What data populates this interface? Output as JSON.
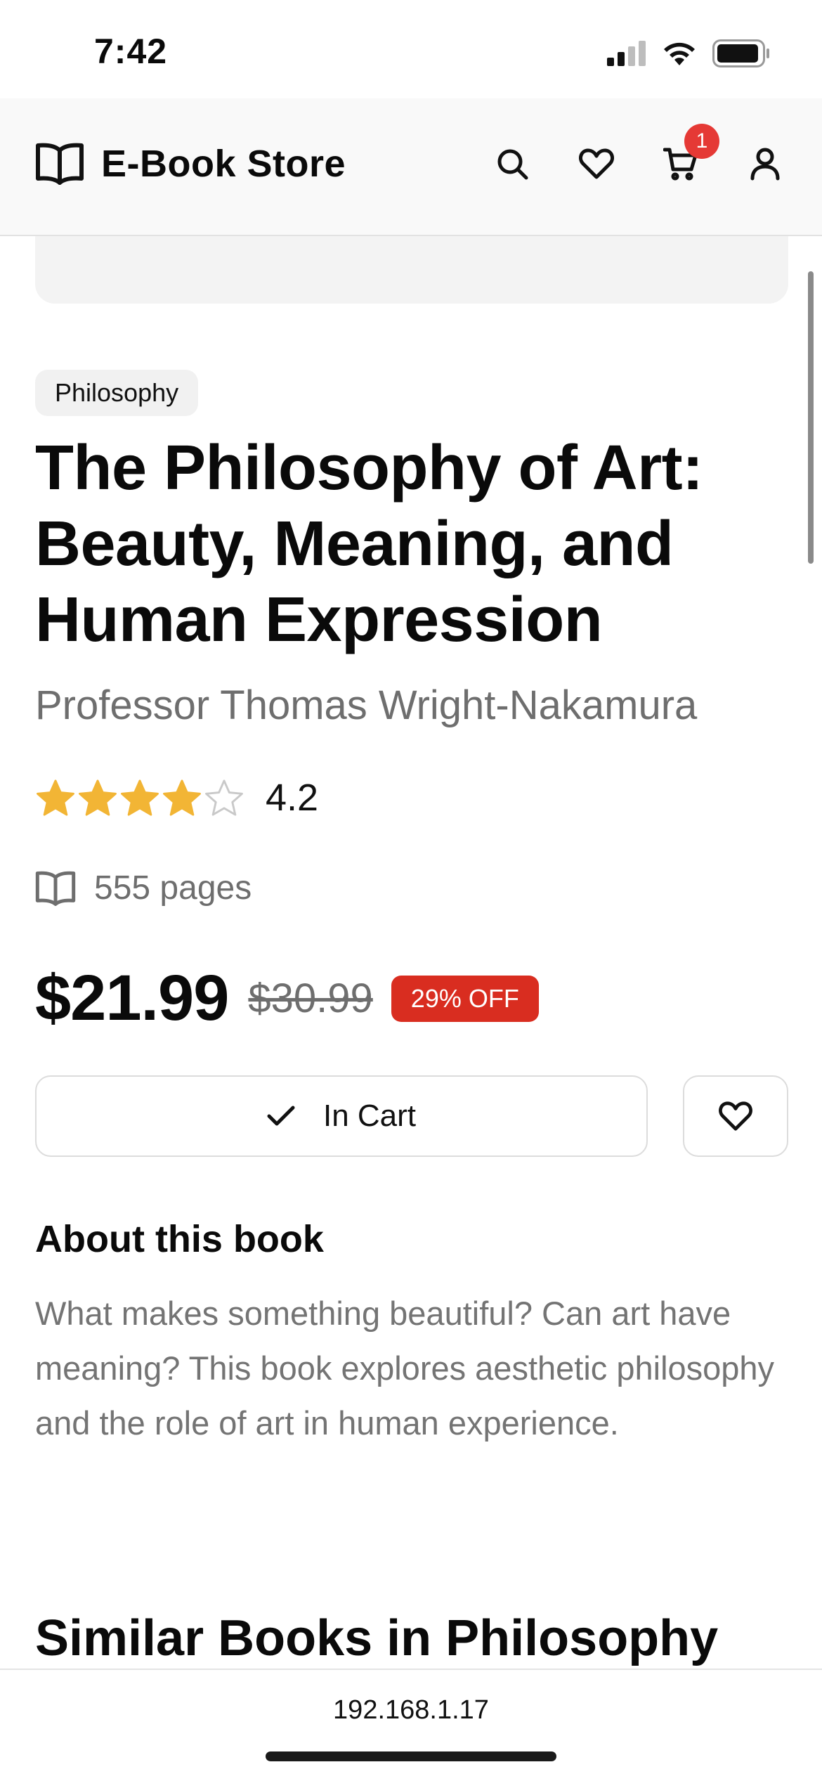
{
  "status_bar": {
    "time": "7:42"
  },
  "header": {
    "brand": "E-Book Store",
    "cart_count": "1",
    "icons": [
      "book-open-icon",
      "search-icon",
      "heart-icon",
      "cart-icon",
      "user-icon"
    ]
  },
  "book": {
    "category": "Philosophy",
    "title": "The Philosophy of Art: Beauty, Meaning, and Human Expression",
    "author": "Professor Thomas Wright-Nakamura",
    "rating": "4.2",
    "rating_value": 4.2,
    "rating_max": 5,
    "pages": "555 pages",
    "price": "$21.99",
    "original_price": "$30.99",
    "discount": "29% OFF"
  },
  "actions": {
    "cart_label": "In Cart"
  },
  "about": {
    "heading": "About this book",
    "text": "What makes something beautiful? Can art have meaning? This book explores aesthetic philosophy and the role of art in human experience."
  },
  "similar": {
    "heading": "Similar Books in Philosophy"
  },
  "browser": {
    "url": "192.168.1.17"
  },
  "colors": {
    "star": "#f2b535",
    "discount": "#d92d20",
    "badge": "#e53935",
    "muted_text": "#6e6e6e"
  }
}
